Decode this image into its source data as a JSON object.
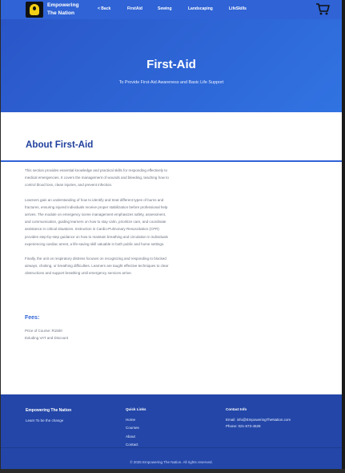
{
  "header": {
    "brand_line1": "Empowering",
    "brand_line2": "The Nation",
    "nav": [
      "< Back",
      "FirstAid",
      "Sewing",
      "Landscaping",
      "LifeSkills"
    ]
  },
  "hero": {
    "title": "First-Aid",
    "subtitle": "To Provide First-Aid Awareness and Basic Life Support"
  },
  "about": {
    "title": "About First-Aid",
    "paragraphs": [
      "This section provides essential knowledge and practical skills for responding effectively to medical emergencies. It covers the management of wounds and bleeding, teaching how to control blood loss, clean injuries, and prevent infection.",
      "Learners gain an understanding of how to identify and treat different types of burns and fractures, ensuring injured individuals receive proper stabilization before professional help arrives. The module on emergency scene management emphasizes safety, assessment, and communication, guiding learners on how to stay calm, prioritize care, and coordinate assistance in critical situations. Instruction in Cardio-Pulmonary Resuscitation (CPR) provides step-by-step guidance on how to maintain breathing and circulation in individuals experiencing cardiac arrest, a life-saving skill valuable in both public and home settings.",
      "Finally, the unit on respiratory distress focuses on recognizing and responding to blocked airways, choking, or breathing difficulties. Learners are taught effective techniques to clear obstructions and support breathing until emergency services arrive."
    ]
  },
  "fees": {
    "title": "Fees:",
    "price": "Price of Course: R1500",
    "note": "Exluding VAT and Discount"
  },
  "footer": {
    "brand": "Empowering The Nation",
    "tagline": "Learn To be the change",
    "quick_links_title": "Quick Links",
    "links": [
      "Home",
      "Courses",
      "About",
      "Contact"
    ],
    "contact_title": "Contact Info",
    "email": "Email: info@EmpoweringTheNation.com",
    "phone": "Phone: 021-673-4528",
    "copyright": "© 2025 Empowering The Nation. All rights reserved."
  },
  "icons": {
    "logo": "lightbulb-logo",
    "cart": "shopping-cart-icon"
  },
  "colors": {
    "primary": "#2f63d6",
    "title": "#1f3f9c",
    "footer": "#2346a8"
  }
}
